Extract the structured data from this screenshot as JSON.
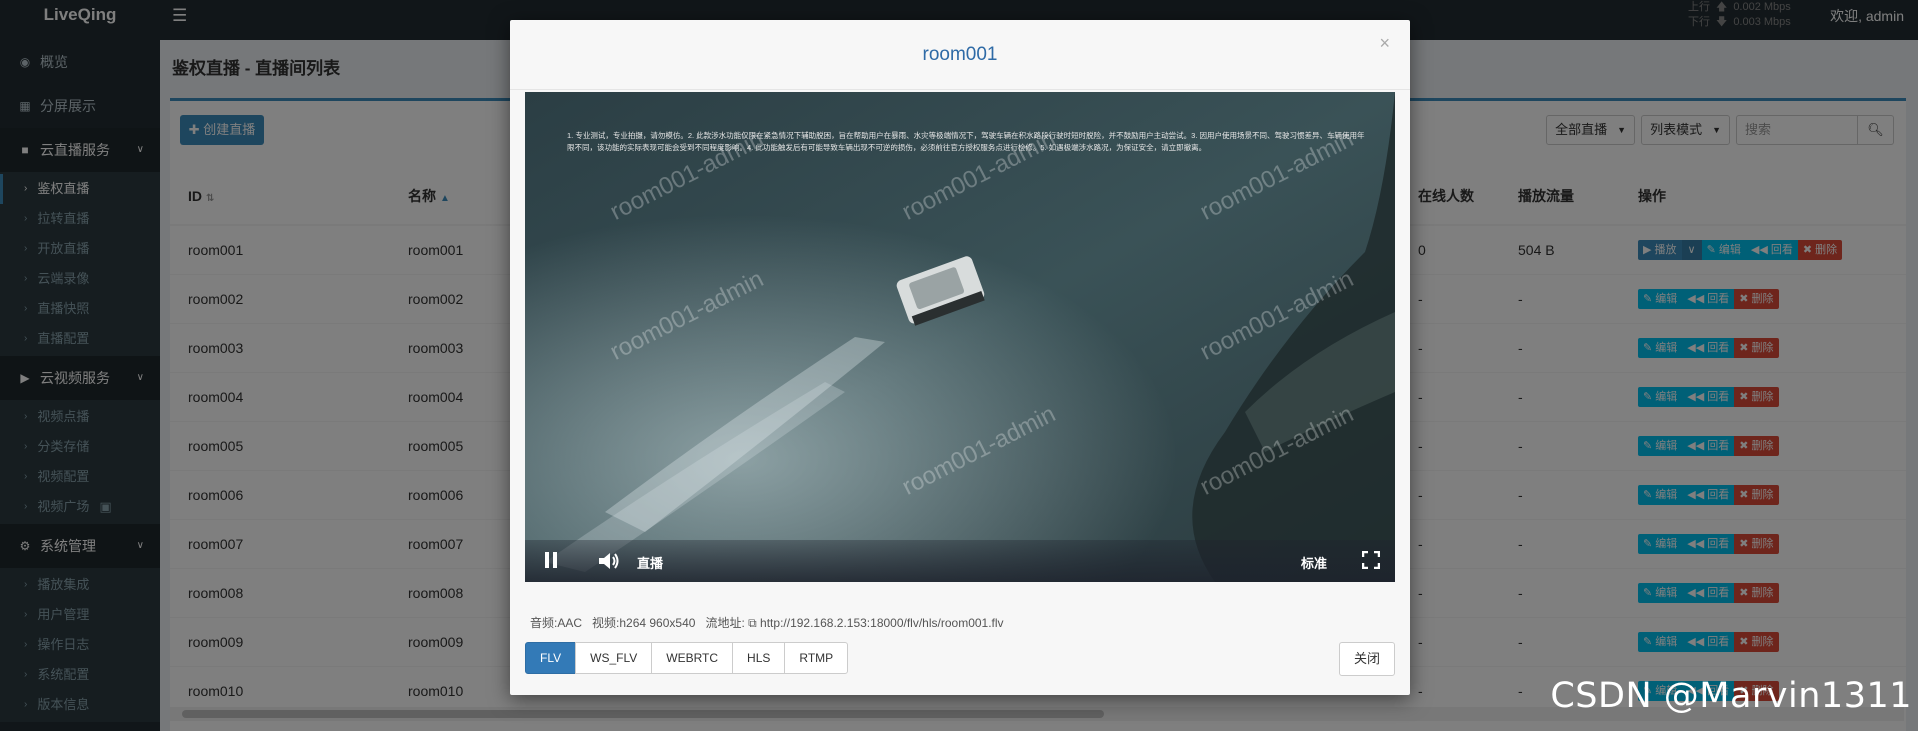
{
  "app": {
    "logo": "LiveQing",
    "welcome": "欢迎, admin",
    "net_up": "0.002 Mbps",
    "net_down": "0.003 Mbps",
    "net_up_label": "上行",
    "net_down_label": "下行"
  },
  "sidebar": {
    "overview": "概览",
    "split_screen": "分屏展示",
    "live_group": "云直播服务",
    "live_items": [
      "鉴权直播",
      "拉转直播",
      "开放直播",
      "云端录像",
      "直播快照",
      "直播配置"
    ],
    "video_group": "云视频服务",
    "video_items": [
      "视频点播",
      "分类存储",
      "视频配置",
      "视频广场"
    ],
    "system_group": "系统管理",
    "system_items": [
      "播放集成",
      "用户管理",
      "操作日志",
      "系统配置",
      "版本信息"
    ]
  },
  "page": {
    "title": "鉴权直播 - 直播间列表",
    "create_button": "创建直播",
    "filter_type": "全部直播",
    "filter_mode": "列表模式",
    "search_placeholder": "搜索"
  },
  "table": {
    "headers": {
      "id": "ID",
      "name": "名称",
      "online": "在线人数",
      "traffic": "播放流量",
      "ops": "操作"
    },
    "rows": [
      {
        "id": "room001",
        "name": "room001",
        "online": "0",
        "traffic": "504 B"
      },
      {
        "id": "room002",
        "name": "room002",
        "online": "-",
        "traffic": "-"
      },
      {
        "id": "room003",
        "name": "room003",
        "online": "-",
        "traffic": "-"
      },
      {
        "id": "room004",
        "name": "room004",
        "online": "-",
        "traffic": "-"
      },
      {
        "id": "room005",
        "name": "room005",
        "online": "-",
        "traffic": "-"
      },
      {
        "id": "room006",
        "name": "room006",
        "online": "-",
        "traffic": "-"
      },
      {
        "id": "room007",
        "name": "room007",
        "online": "-",
        "traffic": "-"
      },
      {
        "id": "room008",
        "name": "room008",
        "online": "-",
        "traffic": "-"
      },
      {
        "id": "room009",
        "name": "room009",
        "online": "-",
        "traffic": "-"
      },
      {
        "id": "room010",
        "name": "room010",
        "online": "-",
        "traffic": "-"
      }
    ],
    "ops": {
      "play": "播放",
      "edit": "编辑",
      "playback": "回看",
      "delete": "删除"
    }
  },
  "modal": {
    "title": "room001",
    "close_x": "×",
    "notice": "1. 专业测试，专业拍摄，请勿模仿。2. 此款涉水功能仅限在紧急情况下辅助脱困，旨在帮助用户在暴雨、水灾等极端情况下，驾驶车辆在积水路段行驶时短时脱险，并不鼓励用户主动尝试。3. 因用户使用场景不同、驾驶习惯差异、车辆使用年限不同，该功能的实际表现可能会受到不同程度影响。4. 此功能触发后有可能导致车辆出现不可逆的损伤，必须前往官方授权服务点进行检修。5. 如遇极端涉水路况，为保证安全，请立即撤离。",
    "watermark": "room001-admin",
    "live_label": "直播",
    "quality": "标准",
    "audio": "音频:AAC",
    "video": "视频:h264 960x540",
    "stream_label": "流地址:",
    "stream_url": "http://192.168.2.153:18000/flv/hls/room001.flv",
    "protocols": [
      "FLV",
      "WS_FLV",
      "WEBRTC",
      "HLS",
      "RTMP"
    ],
    "active_protocol": "FLV",
    "close_button": "关闭"
  },
  "watermark_text": "CSDN @Marvin1311",
  "colors": {
    "accent": "#3c8dbc",
    "sidebar": "#222d32",
    "danger": "#dd4b39",
    "info": "#00c0ef",
    "modal_title": "#2e6aa6"
  }
}
